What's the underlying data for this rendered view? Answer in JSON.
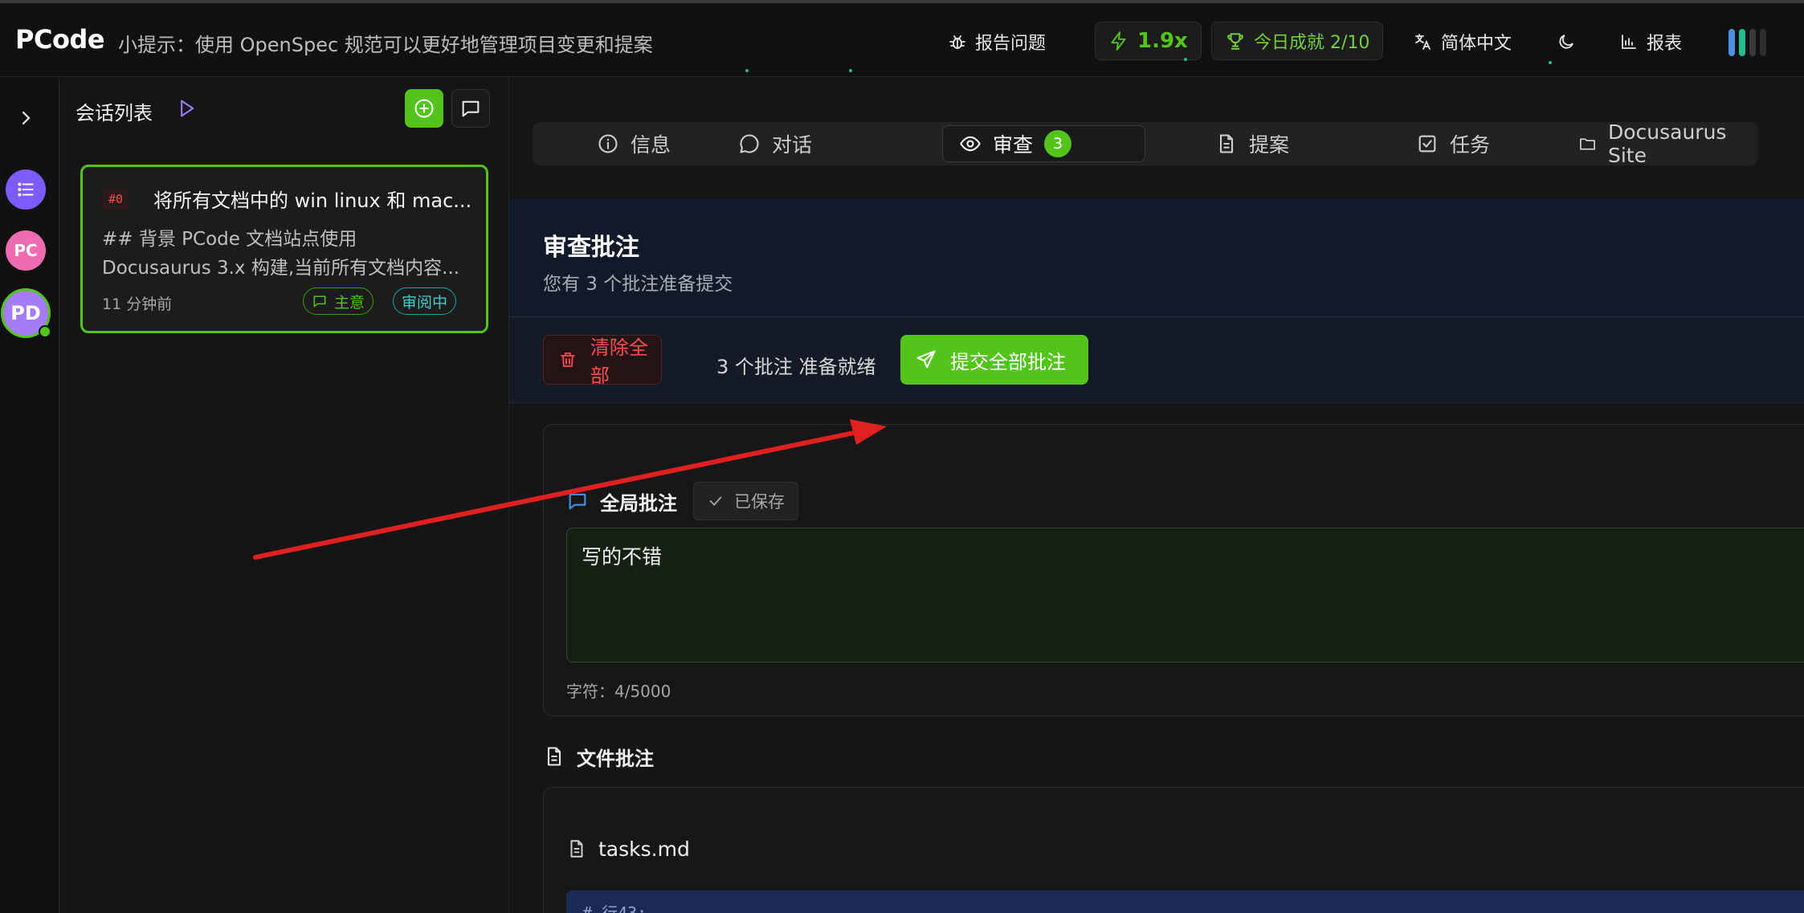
{
  "header": {
    "logo": "PCode",
    "tip": "小提示：使用 OpenSpec 规范可以更好地管理项目变更和提案",
    "report_issue": "报告问题",
    "speed": "1.9x",
    "achievement": "今日成就 2/10",
    "language": "简体中文",
    "reports": "报表"
  },
  "rail": {
    "avatars": [
      {
        "label": "",
        "color": "#7c5cff"
      },
      {
        "label": "PC",
        "color": "#f06bb1"
      },
      {
        "label": "PD",
        "color": "#a57cf6"
      }
    ]
  },
  "session_panel": {
    "title": "会话列表",
    "session": {
      "tag": "#0",
      "title": "将所有文档中的 win linux 和 mac...",
      "desc_line1": "## 背景 PCode 文档站点使用",
      "desc_line2": "Docusaurus 3.x 构建,当前所有文档内容...",
      "time": "11 分钟前",
      "badge_main": "主意",
      "badge_status": "审阅中"
    }
  },
  "tabs": [
    {
      "label": "信息",
      "icon": "info-icon"
    },
    {
      "label": "对话",
      "icon": "chat-icon"
    },
    {
      "label": "审查",
      "icon": "eye-icon",
      "badge": "3",
      "active": true
    },
    {
      "label": "提案",
      "icon": "document-icon"
    },
    {
      "label": "任务",
      "icon": "checkbox-icon"
    },
    {
      "label": "Docusaurus Site",
      "icon": "folder-icon"
    }
  ],
  "review": {
    "title": "审查批注",
    "subtitle": "您有 3 个批注准备提交",
    "clear_all": "清除全部",
    "ready_text": "3 个批注 准备就绪",
    "submit_all": "提交全部批注"
  },
  "global_annotation": {
    "title": "全局批注",
    "saved": "已保存",
    "text": "写的不错",
    "char_count": "字符：4/5000"
  },
  "file_annotations": {
    "title": "文件批注",
    "file_name": "tasks.md",
    "line_label": "# 行43:"
  },
  "colors": {
    "accent_green": "#52c41a",
    "danger_red": "#ff4d4f",
    "annotation_arrow": "#e02020"
  }
}
